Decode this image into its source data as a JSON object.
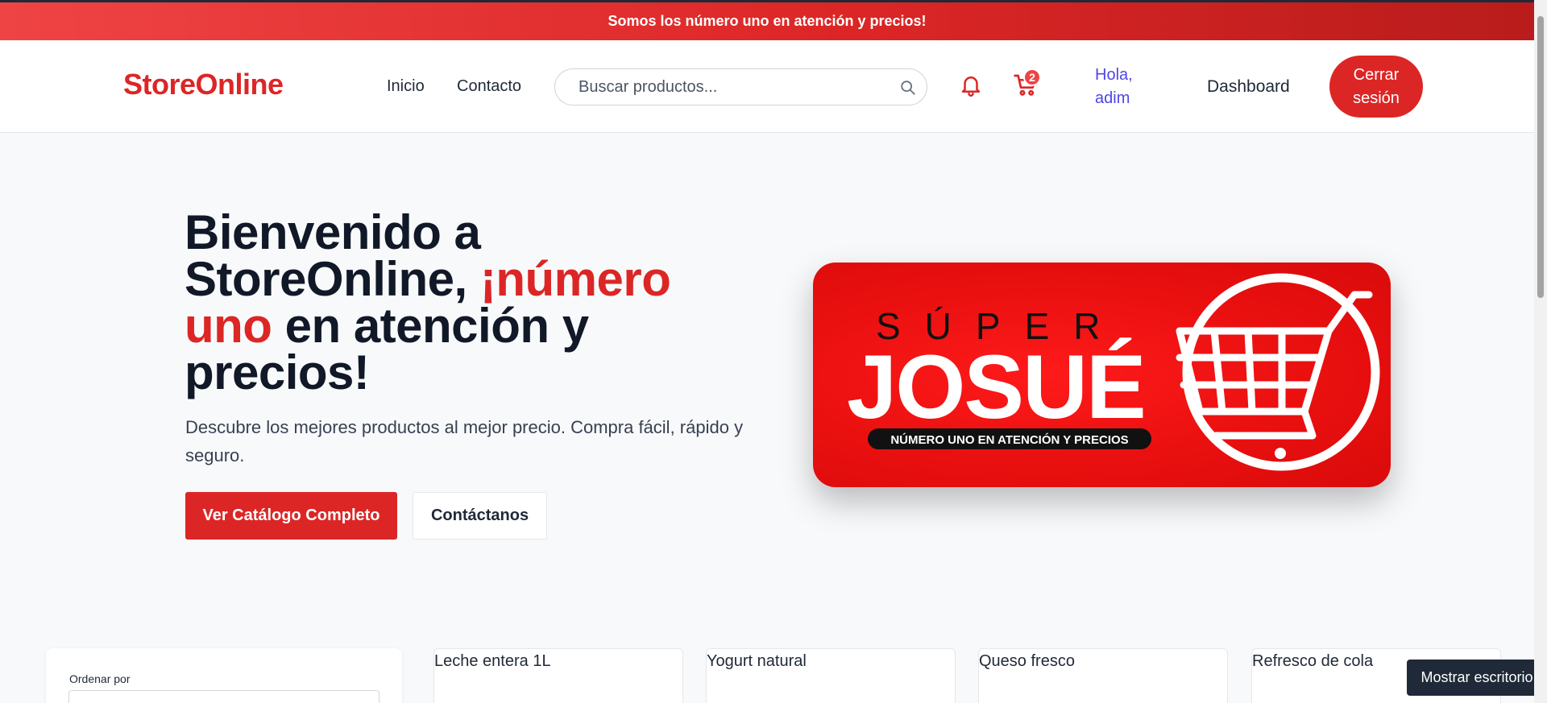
{
  "topbar": {
    "message": "Somos los número uno en atención y precios!"
  },
  "header": {
    "brand": "StoreOnline",
    "nav": [
      {
        "label": "Inicio"
      },
      {
        "label": "Contacto"
      }
    ],
    "search": {
      "placeholder": "Buscar productos...",
      "value": ""
    },
    "cart_count": "2",
    "greeting": "Hola, adim",
    "dashboard_label": "Dashboard",
    "logout_label": "Cerrar sesión"
  },
  "hero": {
    "title_part1": "Bienvenido a StoreOnline, ",
    "title_accent": "¡número uno",
    "title_part2": " en atención y precios!",
    "subtitle": "Descubre los mejores productos al mejor precio. Compra fácil, rápido y seguro.",
    "primary_button": "Ver Catálogo Completo",
    "secondary_button": "Contáctanos"
  },
  "banner": {
    "top_text": "SÚPER",
    "brand_text": "JOSUÉ",
    "tagline": "NÚMERO UNO EN ATENCIÓN Y PRECIOS"
  },
  "filters": {
    "sort_label": "Ordenar por"
  },
  "products": [
    {
      "name": "Leche entera 1L"
    },
    {
      "name": "Yogurt natural"
    },
    {
      "name": "Queso fresco"
    },
    {
      "name": "Refresco de cola"
    }
  ],
  "taskbar": {
    "show_desktop": "Mostrar escritorio"
  },
  "colors": {
    "brand": "#dc2626",
    "greeting": "#4f46e5",
    "text": "#111827"
  },
  "icons": [
    "search-icon",
    "bell-icon",
    "cart-icon"
  ]
}
